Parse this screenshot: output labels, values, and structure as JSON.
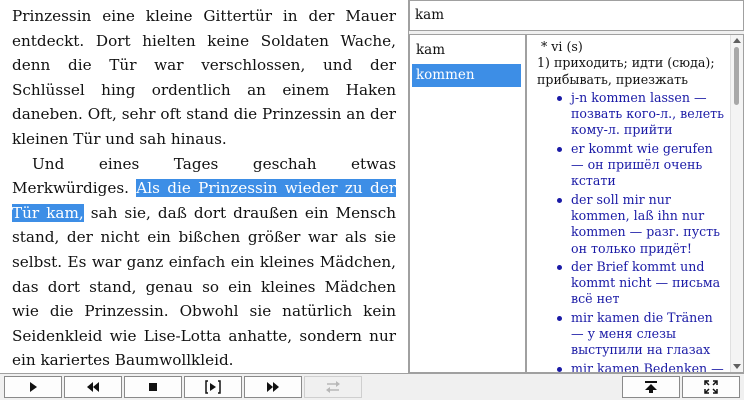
{
  "reader": {
    "para1": "Prinzessin eine kleine Gittertür in der Mauer entdeckt. Dort hielten keine Soldaten Wache, denn die Tür war verschlossen, und der Schlüssel hing ordentlich an einem Haken daneben. Oft, sehr oft stand die Prinzessin an der kleinen Tür und sah hinaus.",
    "para2_start": "Und eines Tages geschah etwas Merkwürdiges.",
    "para2_highlight": "Als die Prinzessin wieder zu der Tür kam,",
    "para2_rest": " sah sie, daß dort draußen ein Mensch stand, der nicht ein bißchen größer war als sie selbst. Es war ganz einfach ein kleines Mädchen, das dort stand, genau so ein kleines Mädchen wie die Prinzessin. Obwohl sie natürlich kein Seidenkleid wie Lise-Lotta anhatte, sondern nur ein kariertes Baumwollkleid."
  },
  "dictionary": {
    "search_value": "kam",
    "words": [
      {
        "label": "kam",
        "selected": false
      },
      {
        "label": "kommen",
        "selected": true
      }
    ],
    "article": {
      "grammar": "* vi (s)",
      "sense_number": "1)",
      "sense_text": "приходить; идти (сюда); прибывать, приезжать",
      "examples": [
        "j-n kommen lassen — позвать кого-л., велеть кому-л. прийти",
        "er kommt wie gerufen — он пришёл очень кстати",
        "der soll mir nur kommen, laß ihn nur kommen — разг. пусть он только придёт!",
        "der Brief kommt und kommt nicht — письма всё нет",
        "mir kamen die Tränen — у меня слезы выступили на глазах",
        "mir kamen Bedenken — "
      ]
    }
  },
  "toolbar": {
    "buttons": [
      {
        "name": "play-button",
        "icon": "play-icon",
        "disabled": false
      },
      {
        "name": "rewind-button",
        "icon": "rewind-icon",
        "disabled": false
      },
      {
        "name": "stop-button",
        "icon": "stop-icon",
        "disabled": false
      },
      {
        "name": "play-sentence-button",
        "icon": "play-sentence-icon",
        "disabled": false
      },
      {
        "name": "fast-forward-button",
        "icon": "fast-forward-icon",
        "disabled": false
      },
      {
        "name": "repeat-button",
        "icon": "repeat-icon",
        "disabled": true
      },
      {
        "name": "top-button",
        "icon": "to-top-icon",
        "disabled": false
      },
      {
        "name": "fullscreen-button",
        "icon": "expand-icon",
        "disabled": false
      }
    ]
  },
  "colors": {
    "highlight": "#3d8ee6",
    "example_text": "#1a1aa6"
  }
}
